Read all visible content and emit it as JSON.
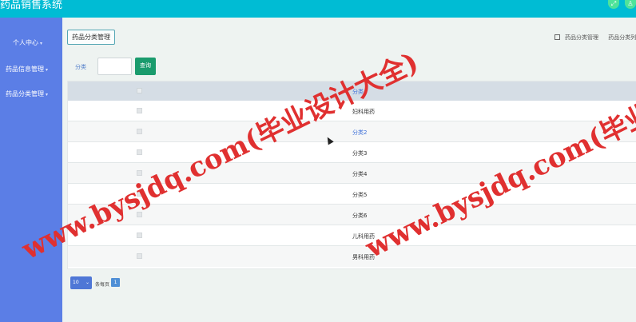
{
  "header": {
    "app_title": "药品销售系统",
    "icons": [
      "expand-icon",
      "user-icon"
    ]
  },
  "sidebar": {
    "items": [
      {
        "label": "个人中心"
      },
      {
        "label": "药品信息管理"
      },
      {
        "label": "药品分类管理"
      }
    ]
  },
  "page": {
    "title_button": "药品分类管理"
  },
  "breadcrumb": {
    "items": [
      "药品分类管理",
      "药品分类列表"
    ]
  },
  "filter": {
    "label": "分类",
    "input_value": "",
    "search_label": "查询"
  },
  "table": {
    "header": "分类",
    "rows": [
      "妇科用药",
      "分类2",
      "分类3",
      "分类4",
      "分类5",
      "分类6",
      "儿科用药",
      "男科用药"
    ]
  },
  "pagination": {
    "page_size": "10",
    "per_page_label": "条每页",
    "current_page": "1"
  },
  "watermark": {
    "text": "www.bysjdq.com(毕业设计大全)",
    "color": "#e03030"
  },
  "colors": {
    "topbar": "#00bcd4",
    "sidebar": "#5b7ee6",
    "search_button": "#1a9b6d",
    "link": "#3c6fd8"
  }
}
